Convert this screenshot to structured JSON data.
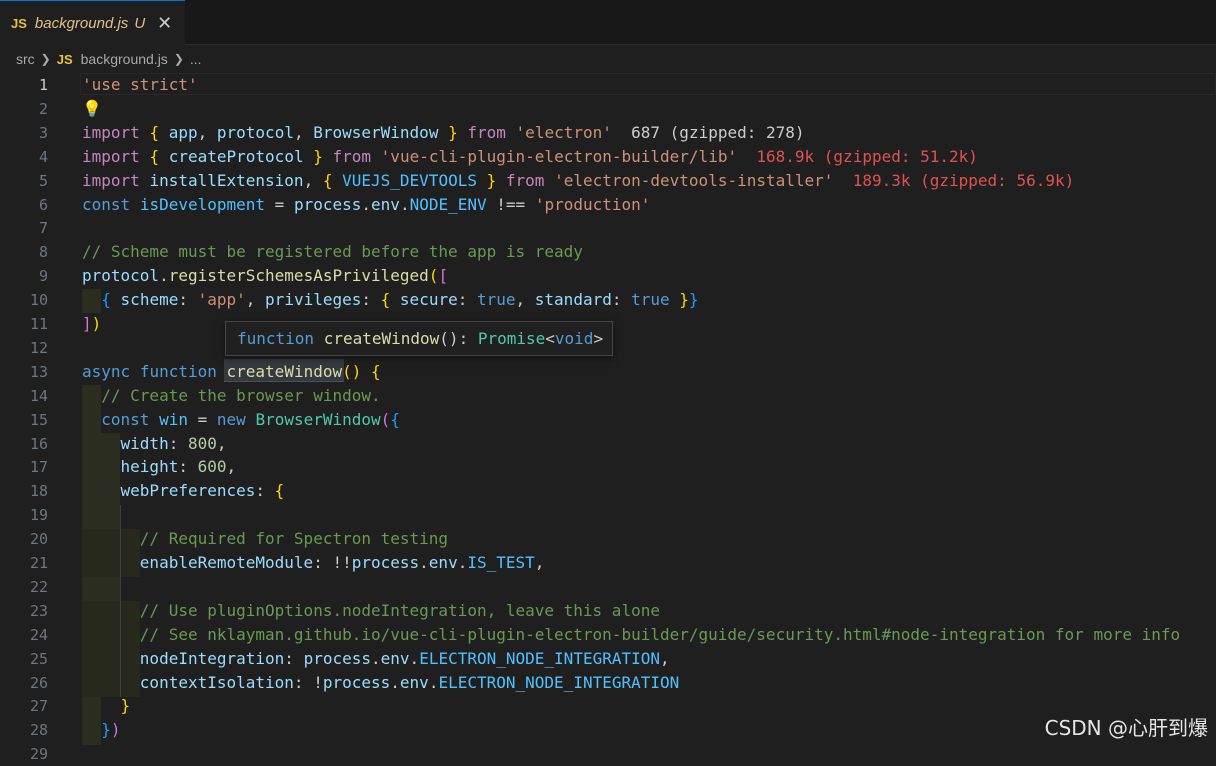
{
  "tab": {
    "badge": "JS",
    "name": "background.js",
    "status": "U",
    "close": "✕"
  },
  "breadcrumb": {
    "folder": "src",
    "badge": "JS",
    "file": "background.js",
    "more": "..."
  },
  "hover": {
    "kw": "function",
    "name": "createWindow",
    "sig": "(): ",
    "type": "Promise",
    "lt": "<",
    "generic": "void",
    "gt": ">"
  },
  "watermark": "CSDN @心肝到爆",
  "code": [
    {
      "n": "1",
      "t": [
        [
          "str",
          "'use strict'"
        ]
      ]
    },
    {
      "n": "2",
      "t": []
    },
    {
      "n": "3",
      "t": [
        [
          "kwc",
          "import"
        ],
        [
          "pn",
          " "
        ],
        [
          "br1",
          "{"
        ],
        [
          "pn",
          " "
        ],
        [
          "var",
          "app"
        ],
        [
          "pn",
          ", "
        ],
        [
          "var",
          "protocol"
        ],
        [
          "pn",
          ", "
        ],
        [
          "var",
          "BrowserWindow"
        ],
        [
          "pn",
          " "
        ],
        [
          "br1",
          "}"
        ],
        [
          "pn",
          " "
        ],
        [
          "kwc",
          "from"
        ],
        [
          "pn",
          " "
        ],
        [
          "str",
          "'electron'"
        ],
        [
          "pn",
          "  "
        ],
        [
          "size-ok",
          "687 (gzipped: 278)"
        ]
      ]
    },
    {
      "n": "4",
      "t": [
        [
          "kwc",
          "import"
        ],
        [
          "pn",
          " "
        ],
        [
          "br1",
          "{"
        ],
        [
          "pn",
          " "
        ],
        [
          "var",
          "createProtocol"
        ],
        [
          "pn",
          " "
        ],
        [
          "br1",
          "}"
        ],
        [
          "pn",
          " "
        ],
        [
          "kwc",
          "from"
        ],
        [
          "pn",
          " "
        ],
        [
          "str",
          "'vue-cli-plugin-electron-builder/lib'"
        ],
        [
          "pn",
          "  "
        ],
        [
          "size-warn",
          "168.9k (gzipped: 51.2k)"
        ]
      ]
    },
    {
      "n": "5",
      "t": [
        [
          "kwc",
          "import"
        ],
        [
          "pn",
          " "
        ],
        [
          "var",
          "installExtension"
        ],
        [
          "pn",
          ", "
        ],
        [
          "br1",
          "{"
        ],
        [
          "pn",
          " "
        ],
        [
          "const",
          "VUEJS_DEVTOOLS"
        ],
        [
          "pn",
          " "
        ],
        [
          "br1",
          "}"
        ],
        [
          "pn",
          " "
        ],
        [
          "kwc",
          "from"
        ],
        [
          "pn",
          " "
        ],
        [
          "str",
          "'electron-devtools-installer'"
        ],
        [
          "pn",
          "  "
        ],
        [
          "size-warn",
          "189.3k (gzipped: 56.9k)"
        ]
      ]
    },
    {
      "n": "6",
      "t": [
        [
          "kw",
          "const"
        ],
        [
          "pn",
          " "
        ],
        [
          "const",
          "isDevelopment"
        ],
        [
          "pn",
          " = "
        ],
        [
          "var",
          "process"
        ],
        [
          "pn",
          "."
        ],
        [
          "var",
          "env"
        ],
        [
          "pn",
          "."
        ],
        [
          "const",
          "NODE_ENV"
        ],
        [
          "pn",
          " !== "
        ],
        [
          "str",
          "'production'"
        ]
      ]
    },
    {
      "n": "7",
      "t": []
    },
    {
      "n": "8",
      "t": [
        [
          "cmt",
          "// Scheme must be registered before the app is ready"
        ]
      ]
    },
    {
      "n": "9",
      "t": [
        [
          "var",
          "protocol"
        ],
        [
          "pn",
          "."
        ],
        [
          "fn",
          "registerSchemesAsPrivileged"
        ],
        [
          "br1",
          "("
        ],
        [
          "br2",
          "["
        ]
      ]
    },
    {
      "n": "10",
      "t": [
        [
          "pn",
          "  "
        ],
        [
          "br3",
          "{"
        ],
        [
          "pn",
          " "
        ],
        [
          "var",
          "scheme"
        ],
        [
          "pn",
          ": "
        ],
        [
          "str",
          "'app'"
        ],
        [
          "pn",
          ", "
        ],
        [
          "var",
          "privileges"
        ],
        [
          "pn",
          ": "
        ],
        [
          "br1",
          "{"
        ],
        [
          "pn",
          " "
        ],
        [
          "var",
          "secure"
        ],
        [
          "pn",
          ": "
        ],
        [
          "kw",
          "true"
        ],
        [
          "pn",
          ", "
        ],
        [
          "var",
          "standard"
        ],
        [
          "pn",
          ": "
        ],
        [
          "kw",
          "true"
        ],
        [
          "pn",
          " "
        ],
        [
          "br1",
          "}"
        ],
        [
          "br3",
          "}"
        ]
      ]
    },
    {
      "n": "11",
      "t": [
        [
          "br2",
          "]"
        ],
        [
          "br1",
          ")"
        ]
      ]
    },
    {
      "n": "12",
      "t": []
    },
    {
      "n": "13",
      "t": [
        [
          "kw",
          "async"
        ],
        [
          "pn",
          " "
        ],
        [
          "kw",
          "function"
        ],
        [
          "pn",
          " "
        ],
        [
          "fn",
          "createWindow"
        ],
        [
          "br1",
          "()"
        ],
        [
          "pn",
          " "
        ],
        [
          "br1",
          "{"
        ]
      ]
    },
    {
      "n": "14",
      "t": [
        [
          "pn",
          "  "
        ],
        [
          "cmt",
          "// Create the browser window."
        ]
      ]
    },
    {
      "n": "15",
      "t": [
        [
          "pn",
          "  "
        ],
        [
          "kw",
          "const"
        ],
        [
          "pn",
          " "
        ],
        [
          "const",
          "win"
        ],
        [
          "pn",
          " = "
        ],
        [
          "kw",
          "new"
        ],
        [
          "pn",
          " "
        ],
        [
          "cls",
          "BrowserWindow"
        ],
        [
          "br2",
          "("
        ],
        [
          "br3",
          "{"
        ]
      ]
    },
    {
      "n": "16",
      "t": [
        [
          "pn",
          "    "
        ],
        [
          "var",
          "width"
        ],
        [
          "pn",
          ": "
        ],
        [
          "num",
          "800"
        ],
        [
          "pn",
          ","
        ]
      ]
    },
    {
      "n": "17",
      "t": [
        [
          "pn",
          "    "
        ],
        [
          "var",
          "height"
        ],
        [
          "pn",
          ": "
        ],
        [
          "num",
          "600"
        ],
        [
          "pn",
          ","
        ]
      ]
    },
    {
      "n": "18",
      "t": [
        [
          "pn",
          "    "
        ],
        [
          "var",
          "webPreferences"
        ],
        [
          "pn",
          ": "
        ],
        [
          "br1",
          "{"
        ]
      ]
    },
    {
      "n": "19",
      "t": []
    },
    {
      "n": "20",
      "t": [
        [
          "pn",
          "      "
        ],
        [
          "cmt",
          "// Required for Spectron testing"
        ]
      ]
    },
    {
      "n": "21",
      "t": [
        [
          "pn",
          "      "
        ],
        [
          "var",
          "enableRemoteModule"
        ],
        [
          "pn",
          ": !!"
        ],
        [
          "var",
          "process"
        ],
        [
          "pn",
          "."
        ],
        [
          "var",
          "env"
        ],
        [
          "pn",
          "."
        ],
        [
          "const",
          "IS_TEST"
        ],
        [
          "pn",
          ","
        ]
      ]
    },
    {
      "n": "22",
      "t": []
    },
    {
      "n": "23",
      "t": [
        [
          "pn",
          "      "
        ],
        [
          "cmt",
          "// Use pluginOptions.nodeIntegration, leave this alone"
        ]
      ]
    },
    {
      "n": "24",
      "t": [
        [
          "pn",
          "      "
        ],
        [
          "cmt",
          "// See nklayman.github.io/vue-cli-plugin-electron-builder/guide/security.html#node-integration for more info"
        ]
      ]
    },
    {
      "n": "25",
      "t": [
        [
          "pn",
          "      "
        ],
        [
          "var",
          "nodeIntegration"
        ],
        [
          "pn",
          ": "
        ],
        [
          "var",
          "process"
        ],
        [
          "pn",
          "."
        ],
        [
          "var",
          "env"
        ],
        [
          "pn",
          "."
        ],
        [
          "const",
          "ELECTRON_NODE_INTEGRATION"
        ],
        [
          "pn",
          ","
        ]
      ]
    },
    {
      "n": "26",
      "t": [
        [
          "pn",
          "      "
        ],
        [
          "var",
          "contextIsolation"
        ],
        [
          "pn",
          ": !"
        ],
        [
          "var",
          "process"
        ],
        [
          "pn",
          "."
        ],
        [
          "var",
          "env"
        ],
        [
          "pn",
          "."
        ],
        [
          "const",
          "ELECTRON_NODE_INTEGRATION"
        ]
      ]
    },
    {
      "n": "27",
      "t": [
        [
          "pn",
          "    "
        ],
        [
          "br1",
          "}"
        ]
      ]
    },
    {
      "n": "28",
      "t": [
        [
          "pn",
          "  "
        ],
        [
          "br3",
          "}"
        ],
        [
          "br2",
          ")"
        ]
      ]
    },
    {
      "n": "29",
      "t": []
    }
  ]
}
